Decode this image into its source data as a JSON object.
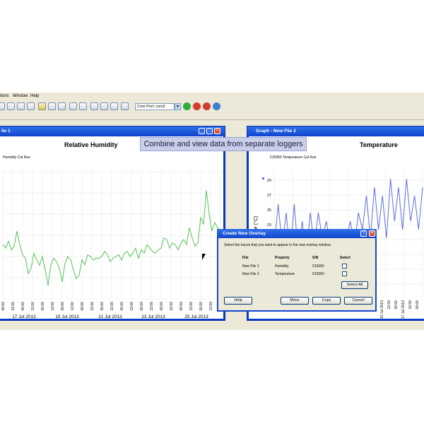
{
  "menu": {
    "options_label": "tions",
    "window_label": "Window",
    "help_label": "Help"
  },
  "toolbar": {
    "com_port_value": "Com Port: com2"
  },
  "left_window": {
    "title": "ile 1",
    "chart_title": "Relative Humidity",
    "legend": "Humidity Cal Run",
    "tick_labels": [
      "00:00",
      "12:00",
      "00:00",
      "12:00",
      "00:00",
      "12:00",
      "00:00",
      "12:00",
      "00:00",
      "12:00",
      "00:00",
      "12:00",
      "00:00",
      "12:00",
      "00:00",
      "12:00",
      "00:00",
      "12:00",
      "00:00",
      "12:00",
      "00:00",
      "12:00",
      "00:00"
    ],
    "date_labels": [
      "17 Jul 2013",
      "19 Jul 2013",
      "21 Jul 2013",
      "23 Jul 2013",
      "25 Jul 2013"
    ]
  },
  "right_window": {
    "title": "Graph - New File 2",
    "chart_title": "Temperature",
    "legend": "515060 Temperature Cal Run",
    "yaxis_label": "ature (°C)",
    "ytick_labels": [
      "29",
      "27",
      "25",
      "23",
      "21",
      "19",
      "17",
      "15"
    ],
    "tick_labels": [
      "15 Jul 2013",
      "12:00",
      "00:00",
      "17 Jul 2013",
      "12:00",
      "00:00"
    ]
  },
  "banner": "Combine and view data from separate loggers",
  "dialog": {
    "title": "Create New Overlay",
    "instruction": "Select the traces that you want to appear in the new overlay window.",
    "headers": [
      "File",
      "Property",
      "S/N",
      "Select"
    ],
    "rows": [
      {
        "file": "New File 1",
        "property": "Humidity",
        "sn": "515060"
      },
      {
        "file": "New File 2",
        "property": "Temperature",
        "sn": "515060"
      }
    ],
    "select_all": "Select All",
    "help": "Help",
    "move": "Move",
    "copy": "Copy",
    "cancel": "Cancel"
  },
  "chart_data": [
    {
      "type": "line",
      "title": "Relative Humidity",
      "series": [
        {
          "name": "Humidity Cal Run",
          "color": "#55c155",
          "values": [
            52,
            50,
            54,
            49,
            51,
            60,
            52,
            46,
            44,
            35,
            38,
            47,
            43,
            40,
            45,
            37,
            28,
            40,
            44,
            42,
            38,
            30,
            41,
            45,
            43,
            37,
            32,
            34,
            43,
            40,
            46,
            45,
            43,
            44,
            44,
            45,
            48,
            46,
            42,
            44,
            45,
            46,
            43,
            47,
            48,
            45,
            47,
            50,
            44,
            49,
            47,
            52,
            50,
            48,
            47,
            49,
            50,
            56,
            55,
            50,
            53,
            52,
            49,
            53,
            55,
            52,
            62,
            56,
            51,
            53,
            68,
            64,
            84,
            70,
            60,
            65,
            62,
            60
          ]
        }
      ],
      "x_labels": [
        "17 Jul 2013",
        "19 Jul 2013",
        "21 Jul 2013",
        "23 Jul 2013",
        "25 Jul 2013"
      ]
    },
    {
      "type": "line",
      "title": "Temperature",
      "ylabel": "ature (°C)",
      "ylim": [
        15,
        30
      ],
      "series": [
        {
          "name": "515060 Temperature Cal Run",
          "color": "#5b6fd6",
          "values": [
            21,
            26,
            21,
            25,
            20,
            26,
            20,
            24,
            20,
            25,
            21,
            25,
            22,
            24,
            21,
            22,
            21,
            23,
            22,
            24,
            21,
            25,
            23,
            27,
            22,
            28,
            23,
            27,
            22,
            29,
            24,
            28,
            23,
            29,
            24,
            27,
            23,
            28
          ]
        }
      ]
    }
  ]
}
